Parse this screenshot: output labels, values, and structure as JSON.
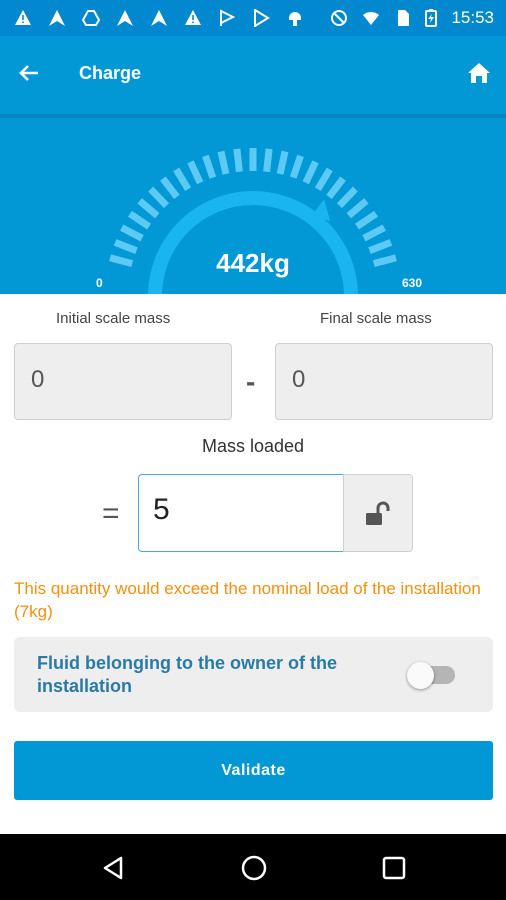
{
  "status_bar": {
    "time": "15:53",
    "icons": [
      "warning-icon",
      "arrowhead-icon",
      "drive-icon",
      "arrowhead-icon",
      "arrowhead-icon",
      "warning-icon",
      "flag-icon",
      "play-store-icon",
      "android-icon",
      "do-not-disturb-icon",
      "wifi-icon",
      "sim-icon",
      "battery-charging-icon"
    ]
  },
  "app_bar": {
    "title": "Charge",
    "back_icon": "arrow-left-icon",
    "home_icon": "home-icon"
  },
  "gauge": {
    "value_label": "442kg",
    "min_label": "0",
    "max_label": "630",
    "min": 0,
    "max": 630,
    "value": 442,
    "ticks": 25,
    "color_track": "#18b5f0",
    "color_tick": "#5ccaf5"
  },
  "form": {
    "initial_label": "Initial scale mass",
    "initial_value": "0",
    "minus": "-",
    "final_label": "Final scale mass",
    "final_value": "0",
    "mass_label": "Mass loaded",
    "equals": "=",
    "mass_value": "5",
    "lock_icon": "unlock-icon",
    "warning": "This quantity would exceed the nominal load of the installation (7kg)",
    "owner_label": "Fluid belonging to the owner of the installation",
    "owner_toggle_on": false,
    "validate_label": "Validate"
  },
  "nav_bar": {
    "icons": [
      "back-triangle-icon",
      "home-circle-icon",
      "recents-square-icon"
    ]
  },
  "colors": {
    "primary": "#0298d6",
    "status_bar": "#0288cf",
    "warning": "#f4900c",
    "owner_text": "#2a7aa6"
  }
}
